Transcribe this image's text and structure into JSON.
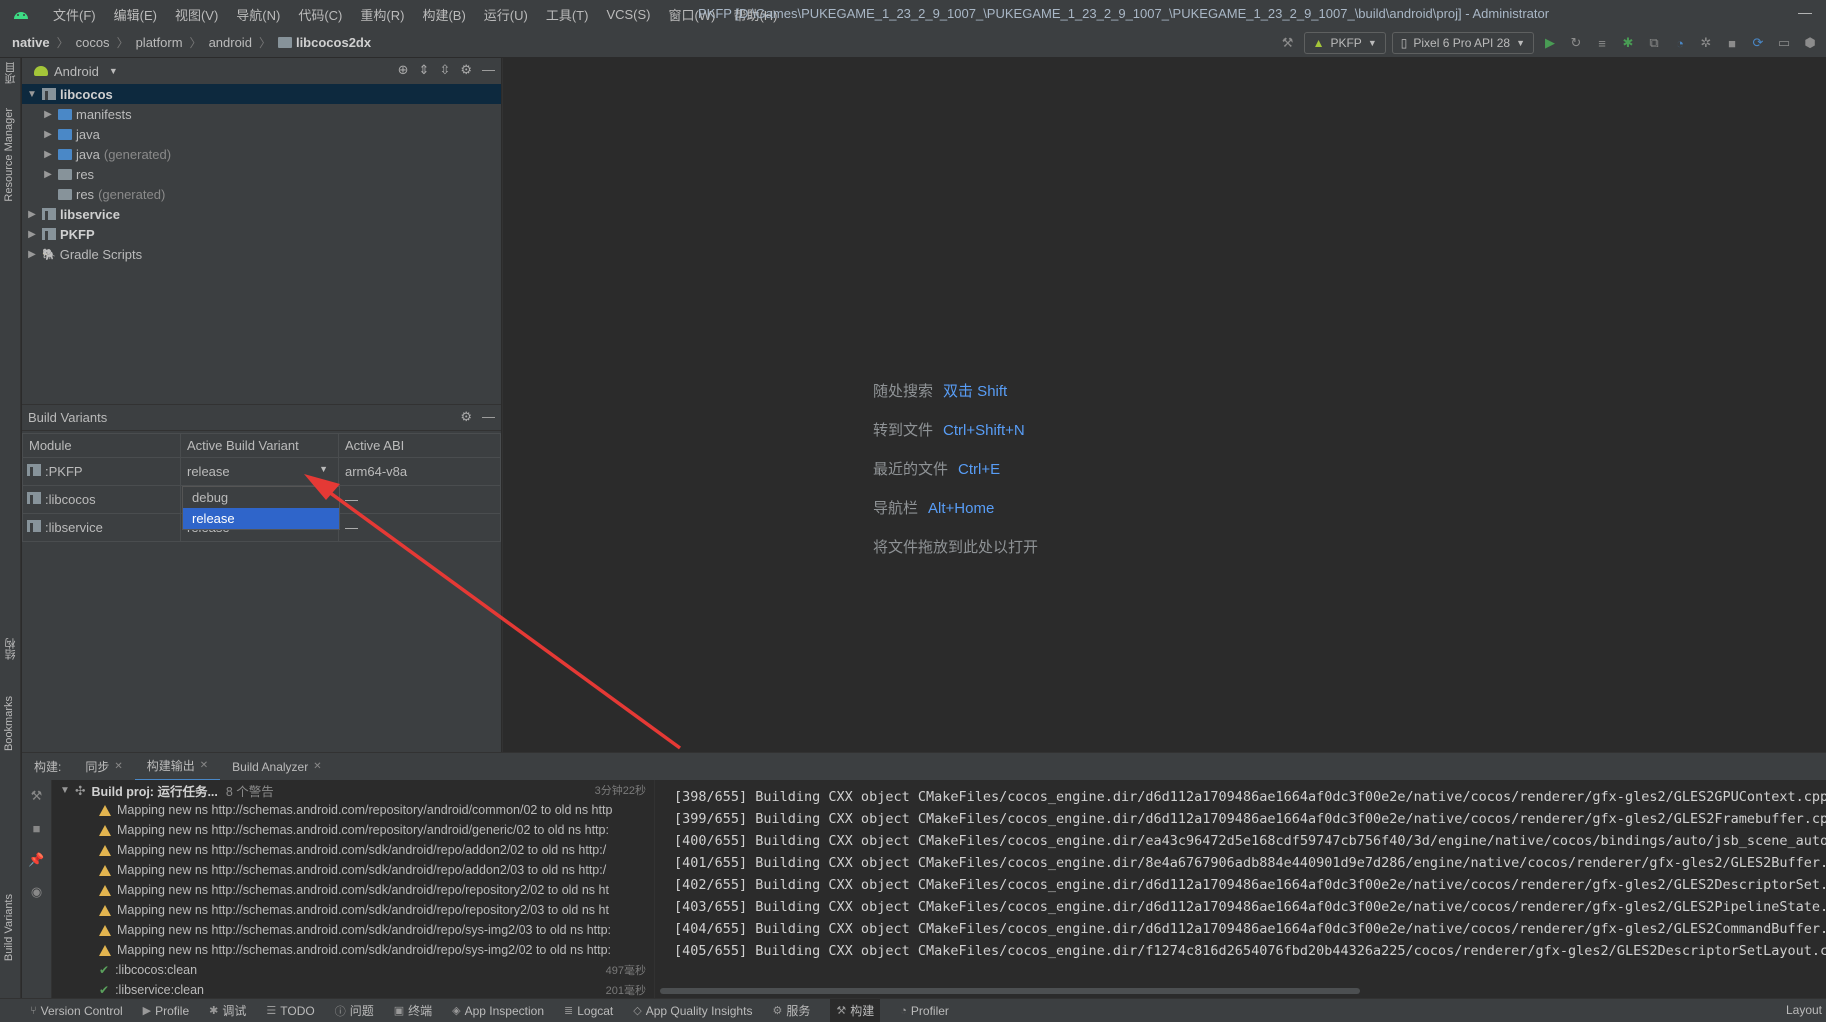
{
  "menubar": {
    "items": [
      "文件(F)",
      "编辑(E)",
      "视图(V)",
      "导航(N)",
      "代码(C)",
      "重构(R)",
      "构建(B)",
      "运行(U)",
      "工具(T)",
      "VCS(S)",
      "窗口(W)",
      "帮助(H)"
    ],
    "title": "PKFP [D:\\Games\\PUKEGAME_1_23_2_9_1007_\\PUKEGAME_1_23_2_9_1007_\\PUKEGAME_1_23_2_9_1007_\\build\\android\\proj] - Administrator",
    "minimize": "—"
  },
  "breadcrumb": [
    "native",
    "cocos",
    "platform",
    "android",
    "libcocos2dx"
  ],
  "toolbar": {
    "run_config": "PKFP",
    "device": "Pixel 6 Pro API 28"
  },
  "left_strip": {
    "project": "项目",
    "resource_manager": "Resource Manager",
    "structure": "结构",
    "bookmarks": "Bookmarks",
    "build_variants": "Build Variants"
  },
  "project": {
    "view": "Android",
    "tree": [
      {
        "label": "libcocos",
        "suffix": "",
        "level": 0,
        "expanded": true,
        "bold": true
      },
      {
        "label": "manifests",
        "suffix": "",
        "level": 1,
        "expanded": false,
        "bold": false
      },
      {
        "label": "java",
        "suffix": "",
        "level": 1,
        "expanded": false,
        "bold": false
      },
      {
        "label": "java",
        "suffix": "(generated)",
        "level": 1,
        "expanded": false,
        "bold": false
      },
      {
        "label": "res",
        "suffix": "",
        "level": 1,
        "expanded": false,
        "bold": false
      },
      {
        "label": "res",
        "suffix": "(generated)",
        "level": 1,
        "expanded": null,
        "bold": false
      },
      {
        "label": "libservice",
        "suffix": "",
        "level": 0,
        "expanded": false,
        "bold": true
      },
      {
        "label": "PKFP",
        "suffix": "",
        "level": 0,
        "expanded": false,
        "bold": true
      },
      {
        "label": "Gradle Scripts",
        "suffix": "",
        "level": 0,
        "expanded": false,
        "bold": false
      }
    ]
  },
  "build_variants": {
    "title": "Build Variants",
    "columns": [
      "Module",
      "Active Build Variant",
      "Active ABI"
    ],
    "rows": [
      {
        "module": ":PKFP",
        "variant": "release",
        "abi": "arm64-v8a"
      },
      {
        "module": ":libcocos",
        "variant": "",
        "abi": "—"
      },
      {
        "module": ":libservice",
        "variant": "release",
        "abi": "—"
      }
    ],
    "dropdown_options": [
      "debug",
      "release"
    ],
    "dropdown_selected": "release"
  },
  "editor_hints": [
    {
      "label": "随处搜索",
      "key": "双击 Shift"
    },
    {
      "label": "转到文件",
      "key": "Ctrl+Shift+N"
    },
    {
      "label": "最近的文件",
      "key": "Ctrl+E"
    },
    {
      "label": "导航栏",
      "key": "Alt+Home"
    },
    {
      "label": "将文件拖放到此处以打开",
      "key": ""
    }
  ],
  "build": {
    "label": "构建:",
    "tabs": [
      "同步",
      "构建输出",
      "Build Analyzer"
    ],
    "active_tab": "构建输出",
    "root": {
      "title": "Build proj: 运行任务...",
      "warnings": "8 个警告",
      "time": "3分钟22秒"
    },
    "items": [
      {
        "type": "warn",
        "text": "Mapping new ns http://schemas.android.com/repository/android/common/02 to old ns http",
        "time": ""
      },
      {
        "type": "warn",
        "text": "Mapping new ns http://schemas.android.com/repository/android/generic/02 to old ns http:",
        "time": ""
      },
      {
        "type": "warn",
        "text": "Mapping new ns http://schemas.android.com/sdk/android/repo/addon2/02 to old ns http:/",
        "time": ""
      },
      {
        "type": "warn",
        "text": "Mapping new ns http://schemas.android.com/sdk/android/repo/addon2/03 to old ns http:/",
        "time": ""
      },
      {
        "type": "warn",
        "text": "Mapping new ns http://schemas.android.com/sdk/android/repo/repository2/02 to old ns ht",
        "time": ""
      },
      {
        "type": "warn",
        "text": "Mapping new ns http://schemas.android.com/sdk/android/repo/repository2/03 to old ns ht",
        "time": ""
      },
      {
        "type": "warn",
        "text": "Mapping new ns http://schemas.android.com/sdk/android/repo/sys-img2/03 to old ns http:",
        "time": ""
      },
      {
        "type": "warn",
        "text": "Mapping new ns http://schemas.android.com/sdk/android/repo/sys-img2/02 to old ns http:",
        "time": ""
      },
      {
        "type": "ok",
        "text": ":libcocos:clean",
        "time": "497毫秒"
      },
      {
        "type": "ok",
        "text": ":libservice:clean",
        "time": "201毫秒"
      }
    ],
    "console": [
      "[398/655] Building CXX object CMakeFiles/cocos_engine.dir/d6d112a1709486ae1664af0dc3f00e2e/native/cocos/renderer/gfx-gles2/GLES2GPUContext.cpp.o",
      "[399/655] Building CXX object CMakeFiles/cocos_engine.dir/d6d112a1709486ae1664af0dc3f00e2e/native/cocos/renderer/gfx-gles2/GLES2Framebuffer.cpp.",
      "[400/655] Building CXX object CMakeFiles/cocos_engine.dir/ea43c96472d5e168cdf59747cb756f40/3d/engine/native/cocos/bindings/auto/jsb_scene_auto.c",
      "[401/655] Building CXX object CMakeFiles/cocos_engine.dir/8e4a6767906adb884e440901d9e7d286/engine/native/cocos/renderer/gfx-gles2/GLES2Buffer.cp",
      "[402/655] Building CXX object CMakeFiles/cocos_engine.dir/d6d112a1709486ae1664af0dc3f00e2e/native/cocos/renderer/gfx-gles2/GLES2DescriptorSet.cp",
      "[403/655] Building CXX object CMakeFiles/cocos_engine.dir/d6d112a1709486ae1664af0dc3f00e2e/native/cocos/renderer/gfx-gles2/GLES2PipelineState.cp",
      "[404/655] Building CXX object CMakeFiles/cocos_engine.dir/d6d112a1709486ae1664af0dc3f00e2e/native/cocos/renderer/gfx-gles2/GLES2CommandBuffer.cp",
      "[405/655] Building CXX object CMakeFiles/cocos_engine.dir/f1274c816d2654076fbd20b44326a225/cocos/renderer/gfx-gles2/GLES2DescriptorSetLayout.cpp"
    ]
  },
  "statusbar": {
    "items": [
      "Version Control",
      "Profile",
      "调试",
      "TODO",
      "问题",
      "终端",
      "App Inspection",
      "Logcat",
      "App Quality Insights",
      "服务",
      "构建",
      "Profiler"
    ],
    "active": "构建",
    "right": "Layout"
  },
  "colors": {
    "accent": "#2f65ca",
    "arrow": "#e53935",
    "warning": "#e2b44f",
    "ok": "#5aa05c",
    "link": "#589df6"
  }
}
